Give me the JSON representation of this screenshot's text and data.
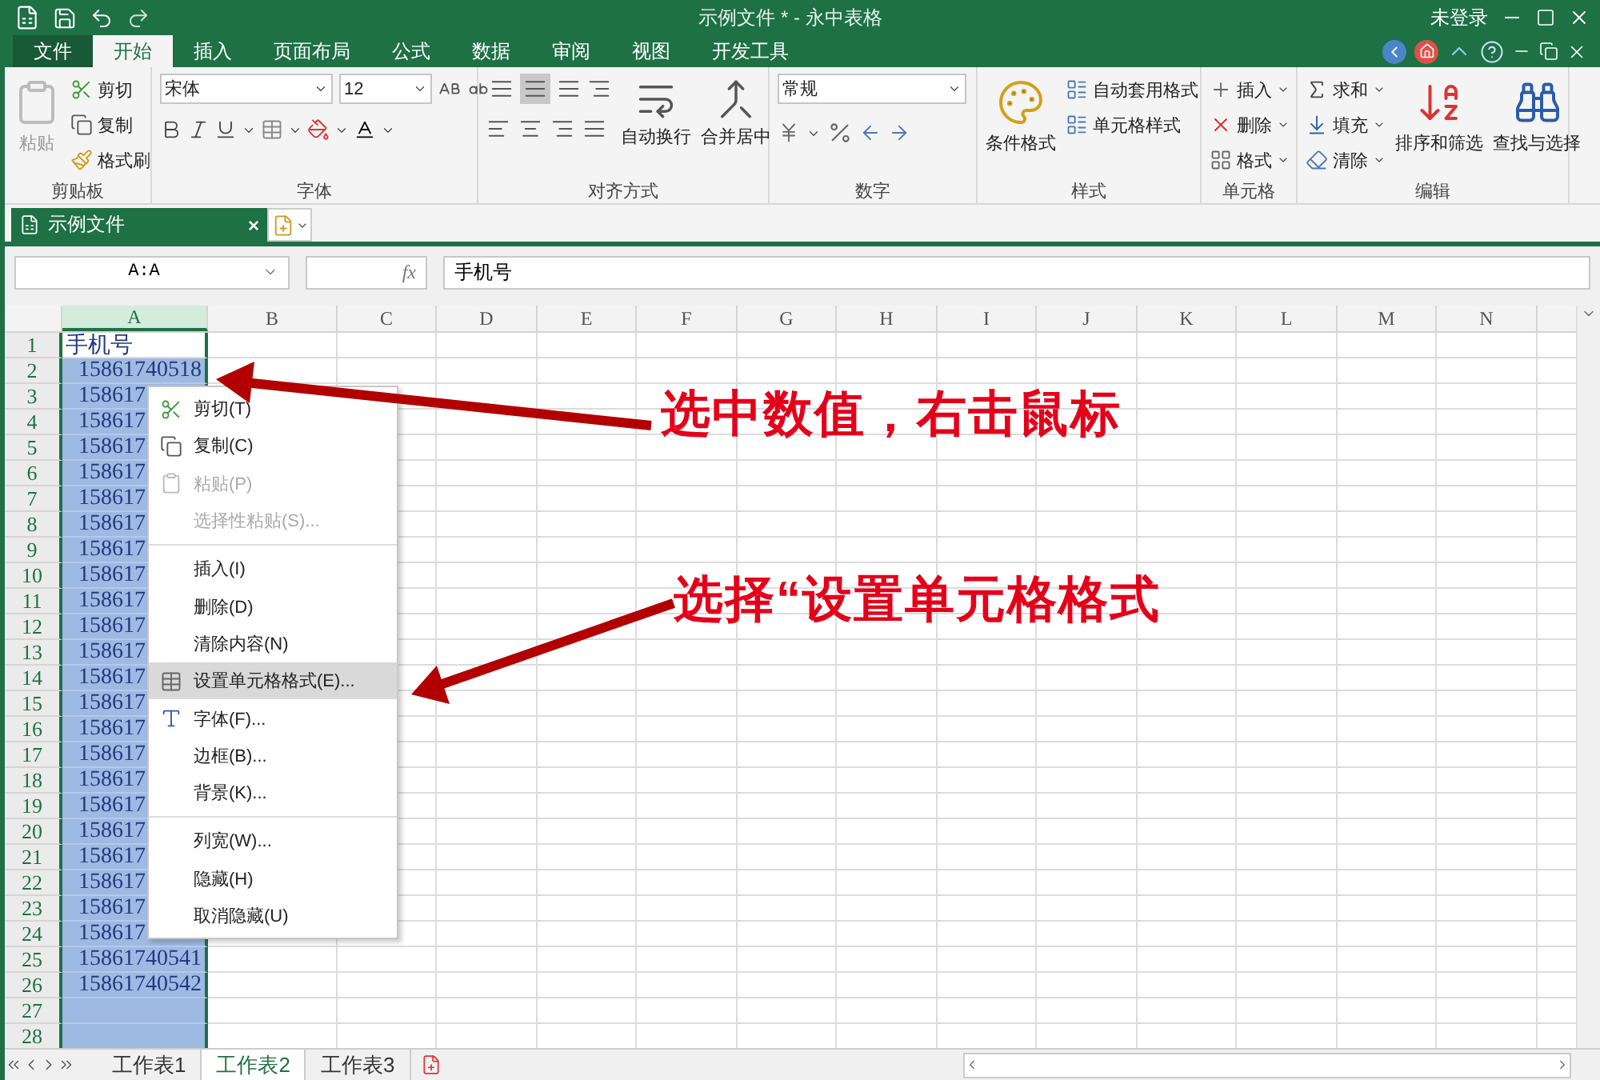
{
  "window": {
    "title": "示例文件 * - 永中表格",
    "user": "未登录"
  },
  "ribbon_tabs": [
    {
      "label": "文件",
      "kind": "file",
      "selected": false
    },
    {
      "label": "开始",
      "kind": "tab",
      "selected": true
    },
    {
      "label": "插入",
      "kind": "tab",
      "selected": false
    },
    {
      "label": "页面布局",
      "kind": "tab",
      "selected": false
    },
    {
      "label": "公式",
      "kind": "tab",
      "selected": false
    },
    {
      "label": "数据",
      "kind": "tab",
      "selected": false
    },
    {
      "label": "审阅",
      "kind": "tab",
      "selected": false
    },
    {
      "label": "视图",
      "kind": "tab",
      "selected": false
    },
    {
      "label": "开发工具",
      "kind": "tab",
      "selected": false
    }
  ],
  "ribbon_groups": [
    {
      "kind": "clipboard",
      "label": "剪贴板",
      "paste": {
        "label": "粘贴",
        "disabled": true
      },
      "items": [
        "剪切",
        "复制",
        "格式刷"
      ]
    },
    {
      "kind": "font",
      "label": "字体",
      "font_name": "宋体",
      "font_size": "12"
    },
    {
      "kind": "alignment",
      "label": "对齐方式",
      "alignments": [
        {
          "selected": false
        },
        {
          "selected": true
        },
        {
          "selected": false
        }
      ],
      "buttons": [
        "自动换行",
        "合并居中"
      ]
    },
    {
      "kind": "number",
      "label": "数字",
      "format": "常规"
    },
    {
      "kind": "styles",
      "label": "样式",
      "large": "条件格式",
      "items": [
        "自动套用格式",
        "单元格样式"
      ]
    },
    {
      "kind": "cells",
      "label": "单元格",
      "items": [
        "插入",
        "删除",
        "格式"
      ]
    },
    {
      "kind": "editing",
      "label": "编辑",
      "items": [
        "求和",
        "填充",
        "清除"
      ],
      "large": [
        "排序和筛选",
        "查找与选择"
      ]
    }
  ],
  "document_tab": {
    "label": "示例文件",
    "close": "×"
  },
  "formula_bar": {
    "name_box": "A:A",
    "fx": "fx",
    "content": "手机号"
  },
  "columns": [
    {
      "label": "A",
      "selected": true
    },
    {
      "label": "B",
      "selected": false
    },
    {
      "label": "C",
      "selected": false
    },
    {
      "label": "D",
      "selected": false
    },
    {
      "label": "E",
      "selected": false
    },
    {
      "label": "F",
      "selected": false
    },
    {
      "label": "G",
      "selected": false
    },
    {
      "label": "H",
      "selected": false
    },
    {
      "label": "I",
      "selected": false
    },
    {
      "label": "J",
      "selected": false
    },
    {
      "label": "K",
      "selected": false
    },
    {
      "label": "L",
      "selected": false
    },
    {
      "label": "M",
      "selected": false
    },
    {
      "label": "N",
      "selected": false
    }
  ],
  "rows": [
    {
      "number": "1",
      "value": "手机号",
      "selected": false
    },
    {
      "number": "2",
      "value": "15861740518",
      "selected": true
    },
    {
      "number": "3",
      "value": "158617",
      "selected": true
    },
    {
      "number": "4",
      "value": "158617",
      "selected": true
    },
    {
      "number": "5",
      "value": "158617",
      "selected": true
    },
    {
      "number": "6",
      "value": "158617",
      "selected": true
    },
    {
      "number": "7",
      "value": "158617",
      "selected": true
    },
    {
      "number": "8",
      "value": "158617",
      "selected": true
    },
    {
      "number": "9",
      "value": "158617",
      "selected": true
    },
    {
      "number": "10",
      "value": "158617",
      "selected": true
    },
    {
      "number": "11",
      "value": "158617",
      "selected": true
    },
    {
      "number": "12",
      "value": "158617",
      "selected": true
    },
    {
      "number": "13",
      "value": "158617",
      "selected": true
    },
    {
      "number": "14",
      "value": "158617",
      "selected": true
    },
    {
      "number": "15",
      "value": "158617",
      "selected": true
    },
    {
      "number": "16",
      "value": "158617",
      "selected": true
    },
    {
      "number": "17",
      "value": "158617",
      "selected": true
    },
    {
      "number": "18",
      "value": "158617",
      "selected": true
    },
    {
      "number": "19",
      "value": "158617",
      "selected": true
    },
    {
      "number": "20",
      "value": "158617",
      "selected": true
    },
    {
      "number": "21",
      "value": "158617",
      "selected": true
    },
    {
      "number": "22",
      "value": "158617",
      "selected": true
    },
    {
      "number": "23",
      "value": "158617",
      "selected": true
    },
    {
      "number": "24",
      "value": "158617",
      "selected": true
    },
    {
      "number": "25",
      "value": "15861740541",
      "selected": true
    },
    {
      "number": "26",
      "value": "15861740542",
      "selected": true
    },
    {
      "number": "27",
      "selected": true
    },
    {
      "number": "28",
      "selected": true
    }
  ],
  "context_menu": [
    {
      "kind": "cut",
      "label": "剪切(T)",
      "disabled": false,
      "selected": false
    },
    {
      "kind": "copy",
      "label": "复制(C)",
      "disabled": false,
      "selected": false
    },
    {
      "kind": "paste",
      "label": "粘贴(P)",
      "disabled": true,
      "selected": false
    },
    {
      "kind": "plain",
      "label": "选择性粘贴(S)...",
      "disabled": true,
      "selected": false
    },
    {
      "kind": "separator"
    },
    {
      "kind": "plain",
      "label": "插入(I)",
      "disabled": false,
      "selected": false
    },
    {
      "kind": "plain",
      "label": "删除(D)",
      "disabled": false,
      "selected": false
    },
    {
      "kind": "plain",
      "label": "清除内容(N)",
      "disabled": false,
      "selected": false
    },
    {
      "kind": "format",
      "label": "设置单元格格式(E)...",
      "disabled": false,
      "selected": true
    },
    {
      "kind": "font",
      "label": "字体(F)...",
      "disabled": false,
      "selected": false
    },
    {
      "kind": "plain",
      "label": "边框(B)...",
      "disabled": false,
      "selected": false
    },
    {
      "kind": "plain",
      "label": "背景(K)...",
      "disabled": false,
      "selected": false
    },
    {
      "kind": "separator"
    },
    {
      "kind": "plain",
      "label": "列宽(W)...",
      "disabled": false,
      "selected": false
    },
    {
      "kind": "plain",
      "label": "隐藏(H)",
      "disabled": false,
      "selected": false
    },
    {
      "kind": "plain",
      "label": "取消隐藏(U)",
      "disabled": false,
      "selected": false
    }
  ],
  "sheet_tabs": [
    {
      "label": "工作表1",
      "selected": false
    },
    {
      "label": "工作表2",
      "selected": true
    },
    {
      "label": "工作表3",
      "selected": false
    }
  ],
  "annotations": [
    {
      "text": "选中数值，右击鼠标"
    },
    {
      "text": "选择“设置单元格格式"
    }
  ]
}
